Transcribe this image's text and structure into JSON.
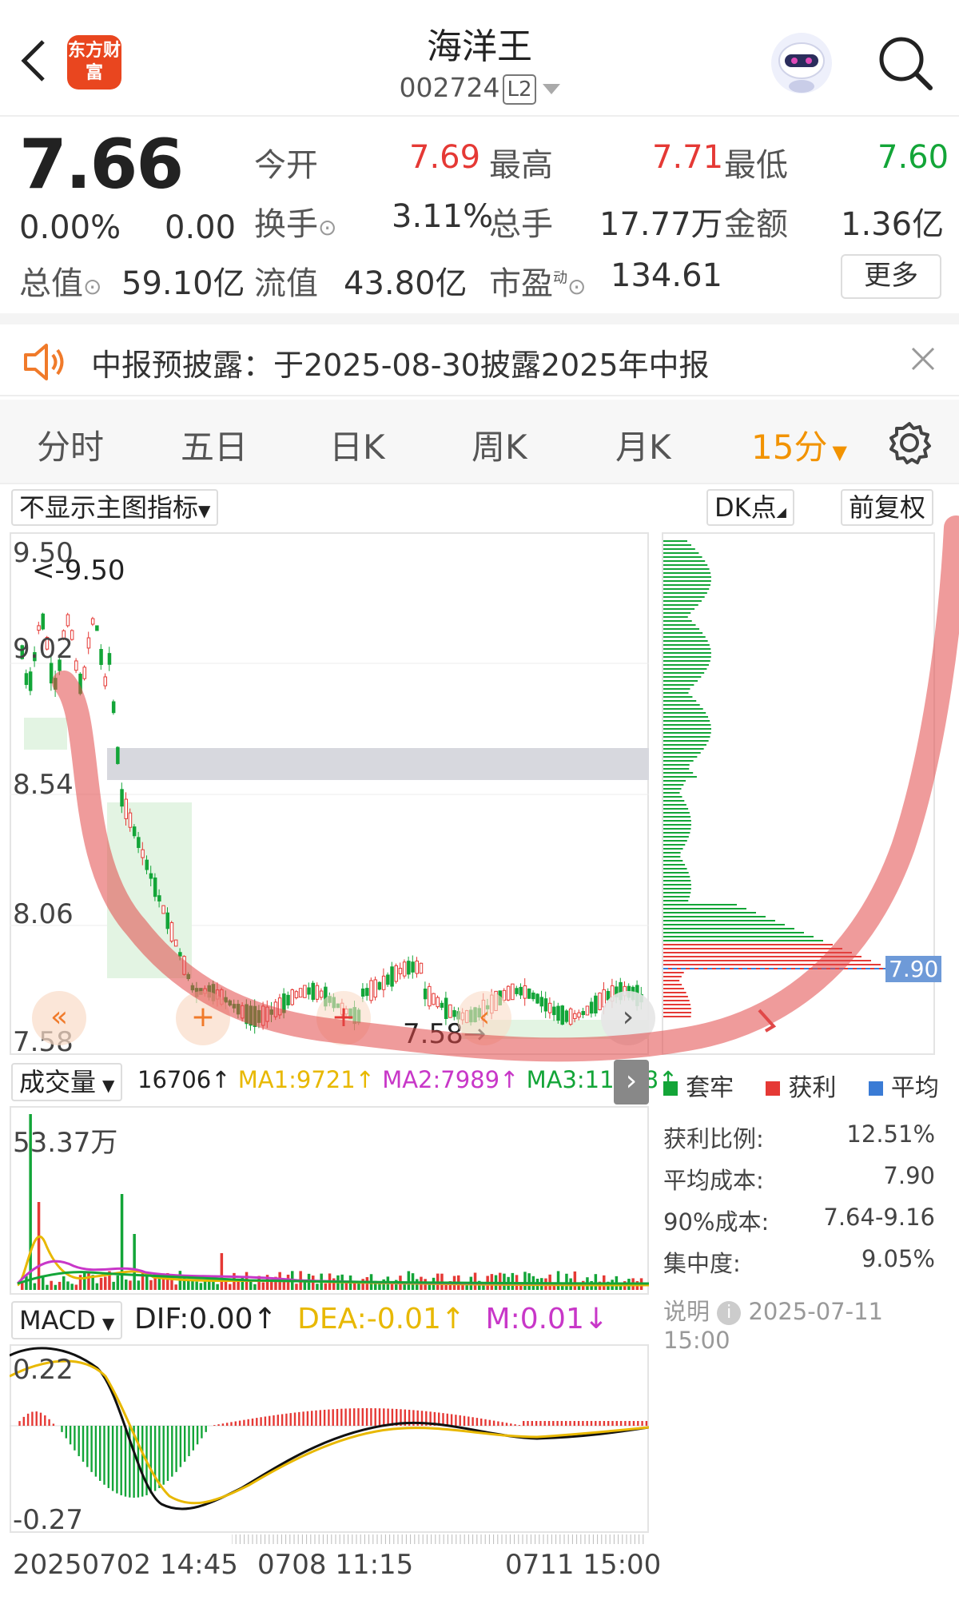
{
  "header": {
    "title": "海洋王",
    "code": "002724",
    "level": "L2",
    "logo_text": "东方财富"
  },
  "quote": {
    "price": "7.66",
    "change_pct": "0.00%",
    "change": "0.00",
    "open_label": "今开",
    "open": "7.69",
    "high_label": "最高",
    "high": "7.71",
    "low_label": "最低",
    "low": "7.60",
    "turnover_label": "换手",
    "turnover": "3.11%",
    "volume_label": "总手",
    "volume": "17.77万",
    "amount_label": "金额",
    "amount": "1.36亿",
    "mktcap_label": "总值",
    "mktcap": "59.10亿",
    "float_label": "流值",
    "float": "43.80亿",
    "pe_label": "市盈",
    "pe_sup": "动",
    "pe": "134.61",
    "more_label": "更多"
  },
  "notice": {
    "text": "中报预披露：于2025-08-30披露2025年中报"
  },
  "tabs": [
    "分时",
    "五日",
    "日K",
    "周K",
    "月K",
    "15分"
  ],
  "options": {
    "indicator": "不显示主图指标",
    "dk": "DK点",
    "adjust": "前复权"
  },
  "main_chart": {
    "y_labels": [
      "9.50",
      "9.02",
      "8.54",
      "8.06",
      "7.58"
    ],
    "max_marker": "<-9.50",
    "last_marker": "7.58"
  },
  "chip_dist": {
    "avg_label": "7.90",
    "legend": {
      "trapped": "套牢",
      "profit": "获利",
      "average": "平均"
    },
    "stats": [
      {
        "label": "获利比例:",
        "value": "12.51%"
      },
      {
        "label": "平均成本:",
        "value": "7.90"
      },
      {
        "label": "90%成本:",
        "value": "7.64-9.16"
      },
      {
        "label": "集中度:",
        "value": "9.05%"
      }
    ],
    "footnote_label": "说明",
    "footnote_time": "2025-07-11 15:00"
  },
  "volume": {
    "selector": "成交量",
    "vol": "16706↑",
    "ma1": "MA1:9721↑",
    "ma2": "MA2:7989↑",
    "ma3": "MA3:11578↑",
    "max_label": "53.37万"
  },
  "macd": {
    "selector": "MACD",
    "dif": "DIF:0.00↑",
    "dea": "DEA:-0.01↑",
    "m": "M:0.01↓",
    "top": "0.22",
    "bottom": "-0.27"
  },
  "x_axis": [
    "20250702 14:45",
    "0708 11:15",
    "0711 15:00"
  ],
  "colors": {
    "up": "#e53935",
    "down": "#13a538",
    "accent": "#f29300",
    "ma1": "#e8b800",
    "ma2": "#c837c8",
    "ma3": "#13a538",
    "dif": "#111111",
    "dea": "#e8b800"
  }
}
